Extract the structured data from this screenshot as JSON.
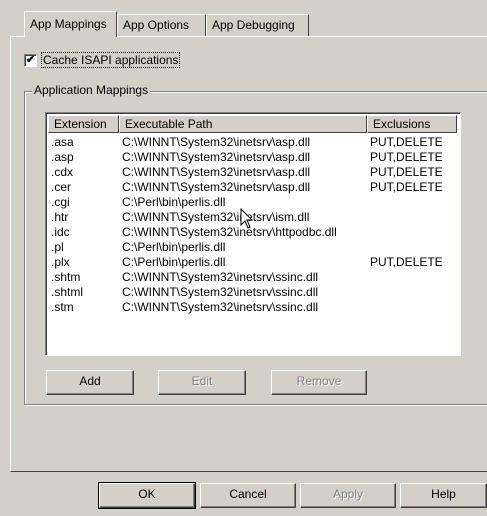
{
  "tabs": [
    {
      "label": "App Mappings",
      "active": true
    },
    {
      "label": "App Options",
      "active": false
    },
    {
      "label": "App Debugging",
      "active": false
    }
  ],
  "cache_checkbox": {
    "label": "Cache ISAPI applications",
    "checked": true,
    "mark": "✔"
  },
  "group_title": "Application Mappings",
  "columns": [
    "Extension",
    "Executable Path",
    "Exclusions"
  ],
  "rows": [
    {
      "ext": ".asa",
      "path": "C:\\WINNT\\System32\\inetsrv\\asp.dll",
      "excl": "PUT,DELETE"
    },
    {
      "ext": ".asp",
      "path": "C:\\WINNT\\System32\\inetsrv\\asp.dll",
      "excl": "PUT,DELETE"
    },
    {
      "ext": ".cdx",
      "path": "C:\\WINNT\\System32\\inetsrv\\asp.dll",
      "excl": "PUT,DELETE"
    },
    {
      "ext": ".cer",
      "path": "C:\\WINNT\\System32\\inetsrv\\asp.dll",
      "excl": "PUT,DELETE"
    },
    {
      "ext": ".cgi",
      "path": "C:\\Perl\\bin\\perlis.dll",
      "excl": ""
    },
    {
      "ext": ".htr",
      "path": "C:\\WINNT\\System32\\inetsrv\\ism.dll",
      "excl": ""
    },
    {
      "ext": ".idc",
      "path": "C:\\WINNT\\System32\\inetsrv\\httpodbc.dll",
      "excl": ""
    },
    {
      "ext": ".pl",
      "path": "C:\\Perl\\bin\\perlis.dll",
      "excl": ""
    },
    {
      "ext": ".plx",
      "path": "C:\\Perl\\bin\\perlis.dll",
      "excl": "PUT,DELETE"
    },
    {
      "ext": ".shtm",
      "path": "C:\\WINNT\\System32\\inetsrv\\ssinc.dll",
      "excl": ""
    },
    {
      "ext": ".shtml",
      "path": "C:\\WINNT\\System32\\inetsrv\\ssinc.dll",
      "excl": ""
    },
    {
      "ext": ".stm",
      "path": "C:\\WINNT\\System32\\inetsrv\\ssinc.dll",
      "excl": ""
    }
  ],
  "mapping_buttons": {
    "add": "Add",
    "edit": "Edit",
    "remove": "Remove"
  },
  "dialog_buttons": {
    "ok": "OK",
    "cancel": "Cancel",
    "apply": "Apply",
    "help": "Help"
  }
}
